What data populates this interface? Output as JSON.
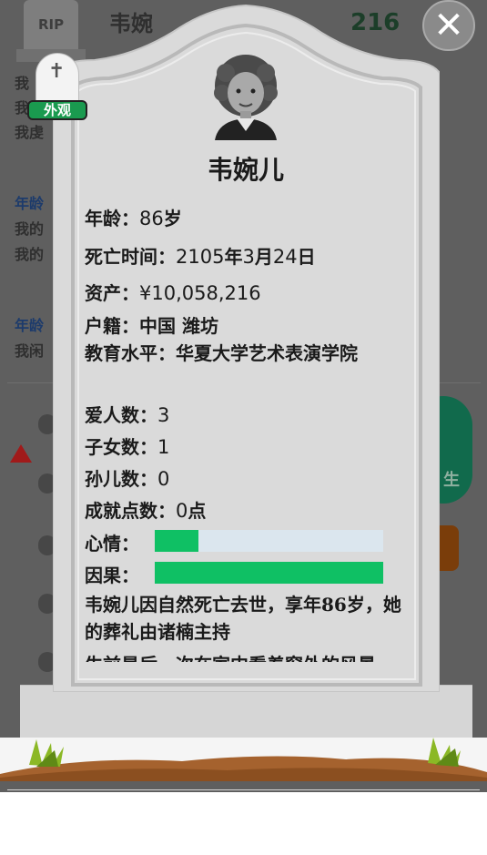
{
  "background": {
    "header_name": "韦婉",
    "money": "216",
    "rip": "RIP",
    "lines": [
      "我",
      "我",
      "我虔"
    ],
    "age_heading": "年龄",
    "age_lines": [
      "我的",
      "我的"
    ],
    "age_heading2": "年龄",
    "age_line3": "我闲",
    "green_button": "生"
  },
  "badge": {
    "label": "外观"
  },
  "close": {
    "label": "✕"
  },
  "profile": {
    "name": "韦婉儿",
    "age_label": "年龄：",
    "age_value": "86",
    "age_unit": "岁",
    "death_label": "死亡时间：",
    "death_value_1": "2105",
    "death_y": "年",
    "death_value_2": "3",
    "death_m": "月",
    "death_value_3": "24",
    "death_d": "日",
    "assets_label": "资产：",
    "assets_value": "¥10,058,216",
    "hukou_label": "户籍：",
    "hukou_value": "中国 潍坊",
    "edu_label": "教育水平：",
    "edu_value": "华夏大学艺术表演学院",
    "lovers_label": "爱人数：",
    "lovers_value": "3",
    "children_label": "子女数：",
    "children_value": "1",
    "grandchildren_label": "孙儿数：",
    "grandchildren_value": "0",
    "achievements_label": "成就点数：",
    "achievements_value": "0",
    "achievements_unit": "点",
    "mood_label": "心情：",
    "mood_level": 0.19,
    "karma_label": "因果：",
    "karma_level": 1.0,
    "epitaph": "韦婉儿因自然死亡去世，享年86岁，她的葬礼由诸楠主持",
    "epitaph_more": "生前最后一次在家中看着窗外的风景"
  },
  "colors": {
    "bar_fill": "#0fc064",
    "bar_track": "#dbe6ee",
    "stone": "#dadada"
  }
}
